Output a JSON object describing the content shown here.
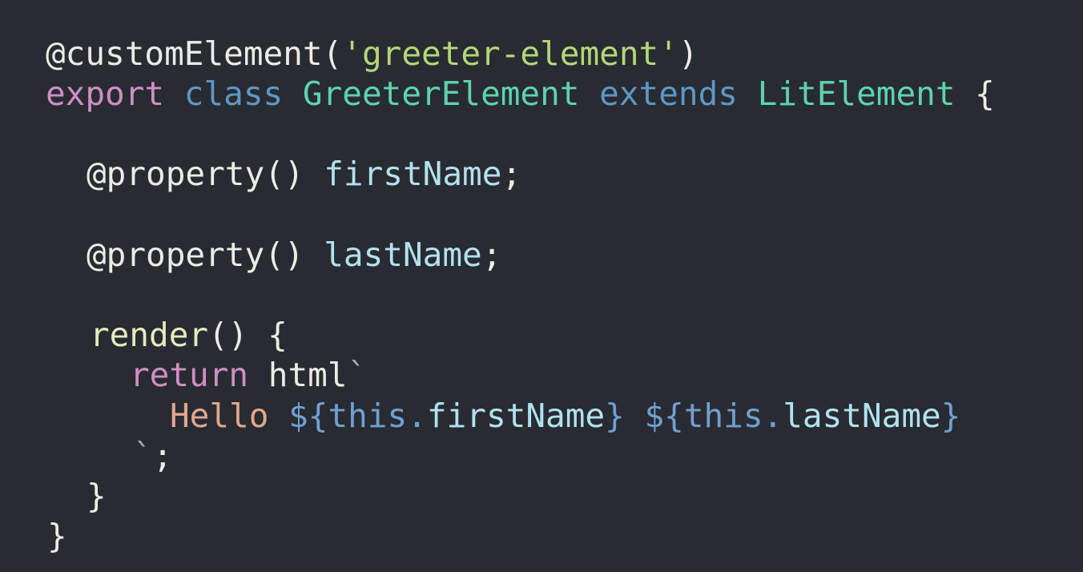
{
  "editor": {
    "lines": [
      {
        "tokens": [
          {
            "text": "@customElement(",
            "role": "plain"
          },
          {
            "text": "'greeter-element'",
            "role": "str"
          },
          {
            "text": ")",
            "role": "plain"
          }
        ]
      },
      {
        "tokens": [
          {
            "text": "export",
            "role": "kw1"
          },
          {
            "text": " ",
            "role": "plain"
          },
          {
            "text": "class",
            "role": "kw2"
          },
          {
            "text": " ",
            "role": "plain"
          },
          {
            "text": "GreeterElement",
            "role": "cls"
          },
          {
            "text": " ",
            "role": "plain"
          },
          {
            "text": "extends",
            "role": "kw2"
          },
          {
            "text": " ",
            "role": "plain"
          },
          {
            "text": "LitElement",
            "role": "cls"
          },
          {
            "text": " {",
            "role": "plain"
          }
        ]
      },
      {
        "tokens": [
          {
            "text": "@property() ",
            "role": "deco"
          },
          {
            "text": "firstName",
            "role": "prop"
          },
          {
            "text": ";",
            "role": "plain"
          }
        ]
      },
      {
        "tokens": [
          {
            "text": "@property() ",
            "role": "deco"
          },
          {
            "text": "lastName",
            "role": "prop"
          },
          {
            "text": ";",
            "role": "plain"
          }
        ]
      },
      {
        "tokens": [
          {
            "text": "render",
            "role": "fn"
          },
          {
            "text": "() {",
            "role": "plain"
          }
        ]
      },
      {
        "tokens": [
          {
            "text": "return",
            "role": "kw1"
          },
          {
            "text": " html",
            "role": "tag"
          },
          {
            "text": "`",
            "role": "tick"
          }
        ]
      },
      {
        "tokens": [
          {
            "text": "Hello ",
            "role": "tpl"
          },
          {
            "text": "${this.",
            "role": "interp"
          },
          {
            "text": "firstName",
            "role": "prop"
          },
          {
            "text": "}",
            "role": "interp"
          },
          {
            "text": " ",
            "role": "tpl"
          },
          {
            "text": "${this.",
            "role": "interp"
          },
          {
            "text": "lastName",
            "role": "prop"
          },
          {
            "text": "}",
            "role": "interp"
          }
        ]
      },
      {
        "tokens": [
          {
            "text": "`",
            "role": "tick"
          },
          {
            "text": ";",
            "role": "plain"
          }
        ]
      },
      {
        "tokens": [
          {
            "text": "}",
            "role": "plain"
          }
        ]
      },
      {
        "tokens": [
          {
            "text": "}",
            "role": "plain"
          }
        ]
      }
    ]
  },
  "colors": {
    "background": "#282b31",
    "plain": "#ecece6",
    "string": "#b3d779",
    "keyword_export_return": "#cf8ec5",
    "keyword_class_extends": "#5e97c8",
    "class_name": "#5ed3ad",
    "property": "#b2e1ef",
    "function": "#e7eabd",
    "template_text": "#e1a78e",
    "interpolation": "#6fa0d1"
  }
}
